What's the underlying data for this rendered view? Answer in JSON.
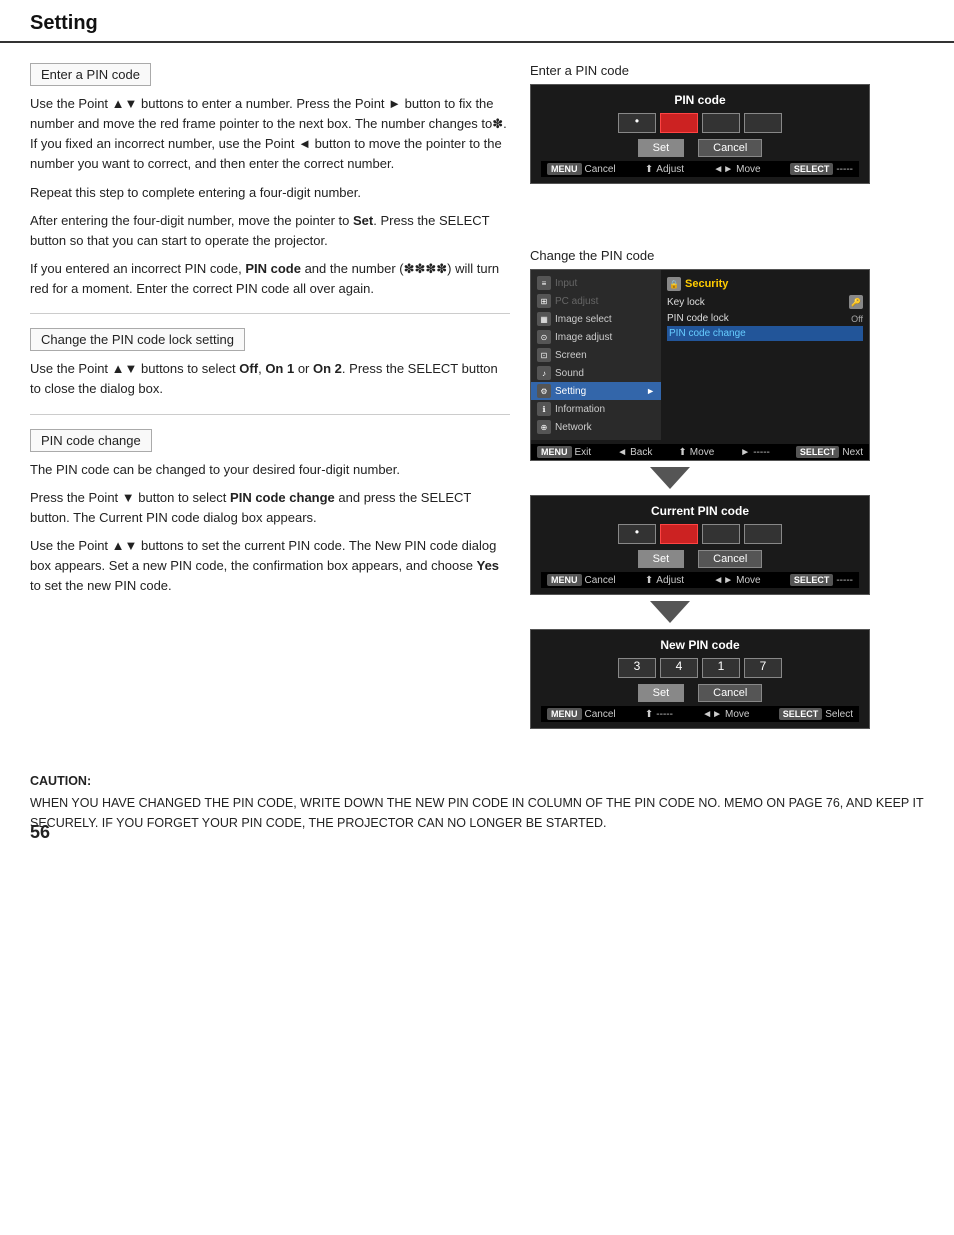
{
  "header": {
    "title": "Setting"
  },
  "page_number": "56",
  "sections": {
    "enter_pin_box": "Enter a PIN code",
    "enter_pin_text1": "Use the Point ▲▼ buttons to enter a number. Press the Point ► button to fix the number and move the red frame pointer to the next box. The number changes to✽. If you fixed an incorrect number, use the Point ◄ button to move the pointer to the number you want to correct, and then enter the correct number.",
    "enter_pin_text2": "Repeat this step to complete entering a four-digit number.",
    "enter_pin_text3": "After entering the four-digit number, move the pointer to Set. Press the SELECT button so that you can start to operate the projector.",
    "enter_pin_text4": "If you entered an incorrect PIN code, PIN code and the number (✽✽✽✽) will turn red for a moment. Enter the correct PIN code all over again.",
    "change_pin_lock_box": "Change the PIN code lock setting",
    "change_pin_lock_text": "Use the Point ▲▼ buttons to select Off, On 1 or On 2. Press the SELECT button to close the dialog box.",
    "pin_code_change_box": "PIN code change",
    "pin_code_change_text1": "The PIN code can be changed to your desired four-digit number.",
    "pin_code_change_text2": "Press the Point ▼ button to select PIN code change and press the SELECT button. The Current PIN code dialog box appears.",
    "pin_code_change_text3": "Use the Point ▲▼ buttons to set the current PIN code. The New PIN code dialog box appears. Set a new PIN code, the confirmation box appears, and choose Yes to set the new PIN code.",
    "caution_title": "CAUTION:",
    "caution_body": "WHEN YOU HAVE CHANGED THE PIN CODE, WRITE DOWN THE NEW PIN CODE IN COLUMN OF THE PIN CODE NO. MEMO ON PAGE 76, AND KEEP IT SECURELY. IF YOU FORGET YOUR PIN CODE, THE PROJECTOR CAN NO LONGER BE STARTED."
  },
  "right_column": {
    "label_top": "Enter a PIN code",
    "pin_dialog_title": "PIN code",
    "pin_fields": [
      "•",
      "",
      "",
      ""
    ],
    "pin_active_index": 1,
    "pin_buttons": [
      "Set",
      "Cancel"
    ],
    "status_cancel": "Cancel",
    "status_adjust": "Adjust",
    "status_move": "Move",
    "status_select": "-----",
    "label_security": "Change the PIN code",
    "security_menu": {
      "left_items": [
        {
          "label": "Input",
          "icon": "≡",
          "active": false,
          "grayed": true
        },
        {
          "label": "PC adjust",
          "icon": "⊞",
          "active": false,
          "grayed": true
        },
        {
          "label": "Image select",
          "icon": "▦",
          "active": false
        },
        {
          "label": "Image adjust",
          "icon": "⊙",
          "active": false
        },
        {
          "label": "Screen",
          "icon": "⊡",
          "active": false
        },
        {
          "label": "Sound",
          "icon": "♪",
          "active": false
        },
        {
          "label": "Setting",
          "icon": "⚙",
          "active": true
        },
        {
          "label": "Information",
          "icon": "ℹ",
          "active": false
        },
        {
          "label": "Network",
          "icon": "⊕",
          "active": false
        }
      ],
      "right_title": "Security",
      "right_items": [
        {
          "label": "Key lock",
          "value": "",
          "icon": true
        },
        {
          "label": "PIN code lock",
          "value": "Off"
        },
        {
          "label": "PIN code change",
          "value": "",
          "selected": true
        }
      ]
    },
    "sec_status_cancel": "Exit",
    "sec_status_back": "Back",
    "sec_status_move": "Move",
    "sec_status_dash": "-----",
    "sec_status_next": "Next",
    "current_pin_title": "Current PIN code",
    "current_pin_fields": [
      "•",
      "",
      "",
      ""
    ],
    "current_pin_buttons": [
      "Set",
      "Cancel"
    ],
    "cur_status_cancel": "Cancel",
    "cur_status_adjust": "Adjust",
    "cur_status_move": "Move",
    "cur_status_select": "-----",
    "new_pin_title": "New PIN code",
    "new_pin_fields": [
      "3",
      "4",
      "1",
      "7"
    ],
    "new_pin_buttons": [
      "Set",
      "Cancel"
    ],
    "new_status_cancel": "Cancel",
    "new_status_dash": "-----",
    "new_status_move": "Move",
    "new_status_select": "Select"
  }
}
